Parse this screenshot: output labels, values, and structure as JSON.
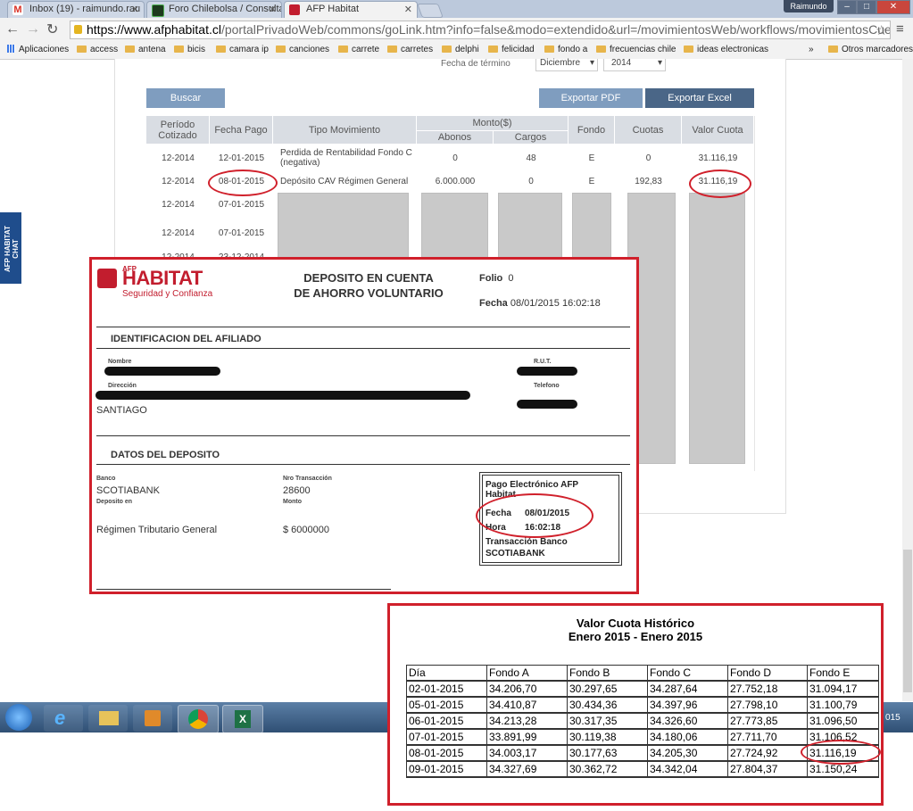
{
  "browser": {
    "tabs": [
      {
        "title": "Inbox (19) - raimundo.rau",
        "color": "#d93025"
      },
      {
        "title": "Foro Chilebolsa / Consulta",
        "color": "#2b6e2b"
      },
      {
        "title": "AFP Habitat",
        "color": "#c21d2e"
      }
    ],
    "user": "Raimundo",
    "url_host": "https://www.afphabitat.cl",
    "url_path": "/portalPrivadoWeb/commons/goLink.htm?info=false&modo=extendido&url=/movimientosWeb/workflows/movimientosCuentaCA",
    "bookmarks": [
      "Aplicaciones",
      "access",
      "antena",
      "bicis",
      "camara ip",
      "canciones",
      "carrete",
      "carretes",
      "delphi",
      "felicidad",
      "fondo a",
      "frecuencias chile",
      "ideas electronicas"
    ],
    "bookmarks_more": "»",
    "other_bookmarks": "Otros marcadores"
  },
  "filters": {
    "end_date_label": "Fecha de término",
    "month": "Diciembre",
    "year": "2014"
  },
  "buttons": {
    "search": "Buscar",
    "export_pdf": "Exportar PDF",
    "export_excel": "Exportar Excel"
  },
  "movements": {
    "headers": {
      "period": "Período Cotizado",
      "pay_date": "Fecha Pago",
      "type": "Tipo Movimiento",
      "amount": "Monto($)",
      "credits": "Abonos",
      "charges": "Cargos",
      "fund": "Fondo",
      "quotas": "Cuotas",
      "quota_value": "Valor Cuota"
    },
    "rows": [
      {
        "period": "12-2014",
        "date": "12-01-2015",
        "type": "Perdida de Rentabilidad Fondo C (negativa)",
        "credit": "0",
        "charge": "48",
        "fund": "E",
        "quotas": "0",
        "value": "31.116,19"
      },
      {
        "period": "12-2014",
        "date": "08-01-2015",
        "type": "Depósito CAV Régimen General",
        "credit": "6.000.000",
        "charge": "0",
        "fund": "E",
        "quotas": "192,83",
        "value": "31.116,19"
      },
      {
        "period": "12-2014",
        "date": "07-01-2015"
      },
      {
        "period": "12-2014",
        "date": "07-01-2015"
      },
      {
        "period": "12-2014",
        "date": "23-12-2014"
      }
    ]
  },
  "chat": {
    "label": "AFP HABITAT CHAT"
  },
  "receipt": {
    "logo_small": "AFP",
    "logo_main": "HABITAT",
    "tagline": "Seguridad y Confianza",
    "title_line1": "DEPOSITO EN CUENTA",
    "title_line2": "DE AHORRO VOLUNTARIO",
    "folio_label": "Folio",
    "folio_value": "0",
    "fecha_label": "Fecha",
    "fecha_value": "08/01/2015 16:02:18",
    "section_affiliate": "IDENTIFICACION DEL AFILIADO",
    "name_label": "Nombre",
    "rut_label": "R.U.T.",
    "address_label": "Dirección",
    "phone_label": "Telefono",
    "city": "SANTIAGO",
    "section_deposit": "DATOS DEL DEPOSITO",
    "bank_label": "Banco",
    "bank_value": "SCOTIABANK",
    "tx_label": "Nro Transacción",
    "tx_value": "28600",
    "deposit_in_label": "Deposito en",
    "amount_label": "Monto",
    "regime": "Régimen Tributario General",
    "amount_value": "$ 6000000",
    "box_title": "Pago Electrónico AFP Habitat",
    "box_fecha_label": "Fecha",
    "box_fecha": "08/01/2015",
    "box_hora_label": "Hora",
    "box_hora": "16:02:18",
    "box_tx_label": "Transacción Banco",
    "box_bank": "SCOTIABANK"
  },
  "historic": {
    "title_line1": "Valor Cuota Histórico",
    "title_line2": "Enero 2015 - Enero 2015",
    "headers": [
      "Día",
      "Fondo A",
      "Fondo B",
      "Fondo C",
      "Fondo D",
      "Fondo E"
    ],
    "rows": [
      [
        "02-01-2015",
        "34.206,70",
        "30.297,65",
        "34.287,64",
        "27.752,18",
        "31.094,17"
      ],
      [
        "05-01-2015",
        "34.410,87",
        "30.434,36",
        "34.397,96",
        "27.798,10",
        "31.100,79"
      ],
      [
        "06-01-2015",
        "34.213,28",
        "30.317,35",
        "34.326,60",
        "27.773,85",
        "31.096,50"
      ],
      [
        "07-01-2015",
        "33.891,99",
        "30.119,38",
        "34.180,06",
        "27.711,70",
        "31.106,52"
      ],
      [
        "08-01-2015",
        "34.003,17",
        "30.177,63",
        "34.205,30",
        "27.724,92",
        "31.116,19"
      ],
      [
        "09-01-2015",
        "34.327,69",
        "30.362,72",
        "34.342,04",
        "27.804,37",
        "31.150,24"
      ]
    ]
  },
  "taskbar": {
    "clock_fragment": "015"
  },
  "colors": {
    "accent_red": "#d0202b",
    "habitat_red": "#c21d2e",
    "button_blue": "#7f9dbf",
    "button_dark": "#4a6687"
  }
}
